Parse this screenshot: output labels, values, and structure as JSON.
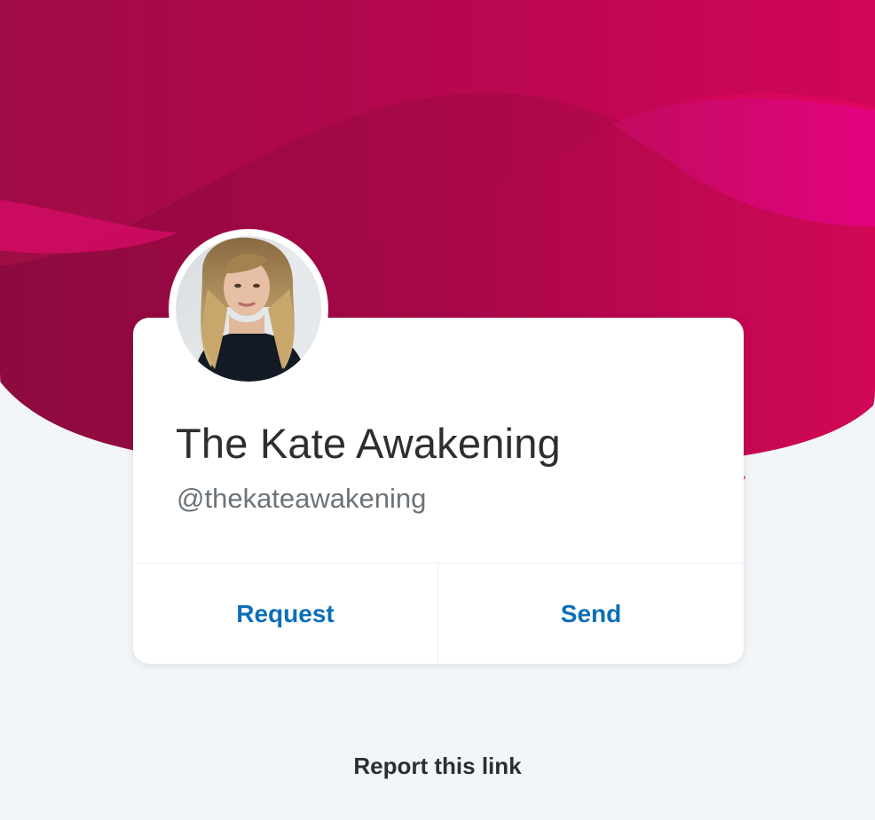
{
  "profile": {
    "name": "The Kate Awakening",
    "handle": "@thekateawakening"
  },
  "actions": {
    "request_label": "Request",
    "send_label": "Send"
  },
  "footer": {
    "report_label": "Report this link"
  },
  "colors": {
    "hero_dark": "#8c0a3e",
    "hero_mid": "#c4094f",
    "hero_bright": "#e10670",
    "action_text": "#0a6fb8",
    "background": "#f3f6f9"
  }
}
